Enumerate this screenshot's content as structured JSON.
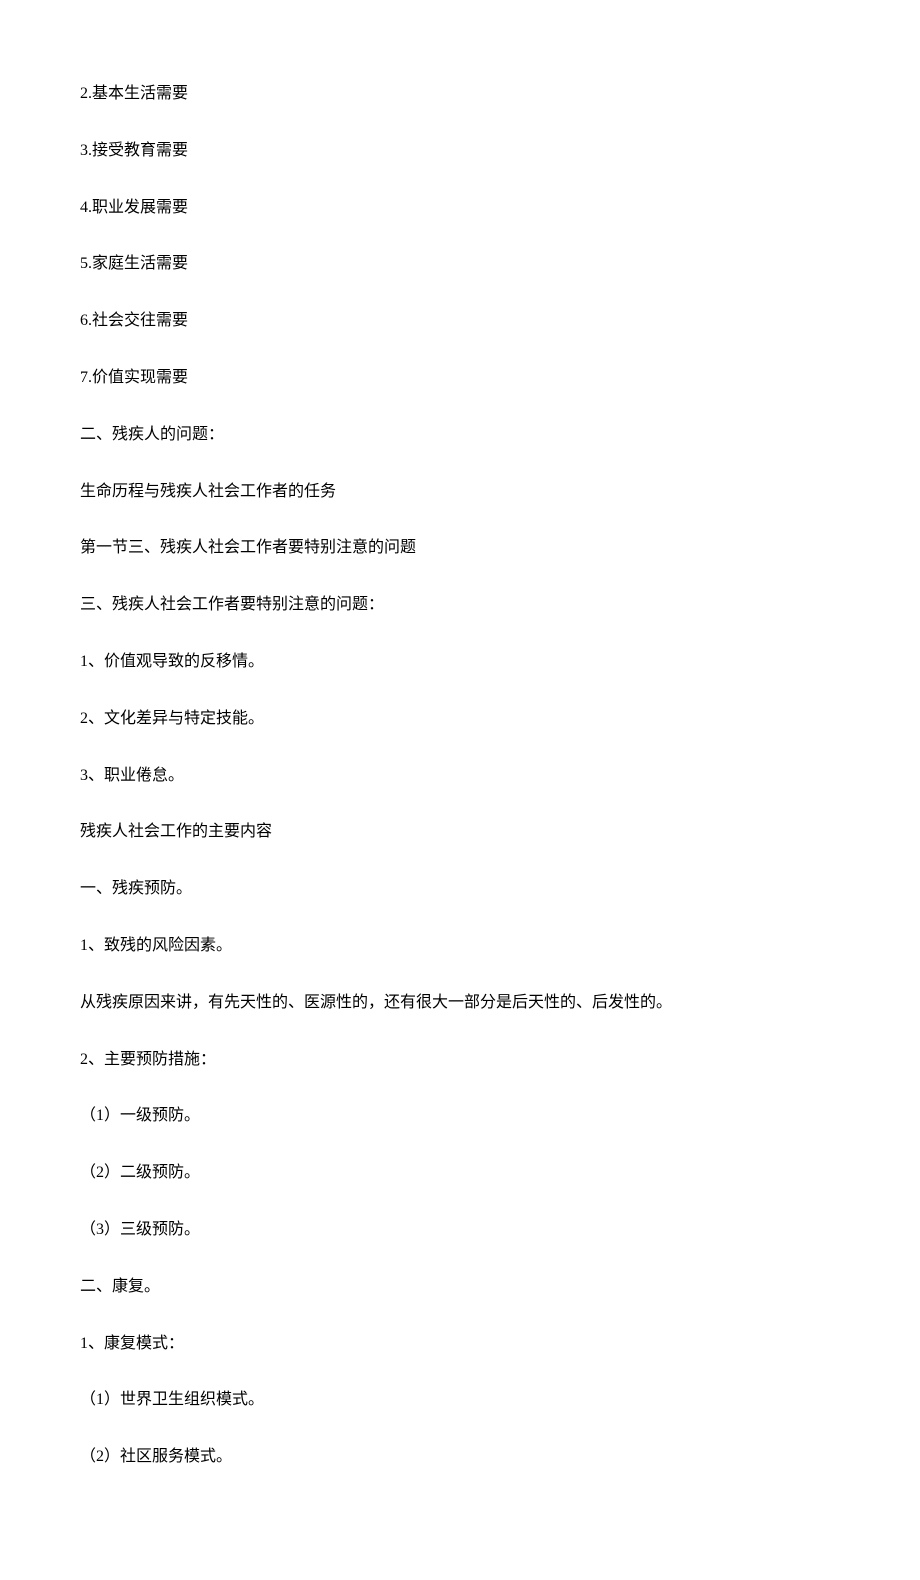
{
  "lines": [
    "2.基本生活需要",
    "3.接受教育需要",
    "4.职业发展需要",
    "5.家庭生活需要",
    "6.社会交往需要",
    "7.价值实现需要",
    "二、残疾人的问题：",
    "生命历程与残疾人社会工作者的任务",
    "第一节三、残疾人社会工作者要特别注意的问题",
    "三、残疾人社会工作者要特别注意的问题：",
    "1、价值观导致的反移情。",
    "2、文化差异与特定技能。",
    "3、职业倦怠。",
    "残疾人社会工作的主要内容",
    "一、残疾预防。",
    "1、致残的风险因素。",
    "从残疾原因来讲，有先天性的、医源性的，还有很大一部分是后天性的、后发性的。",
    "2、主要预防措施：",
    "（1）一级预防。",
    "（2）二级预防。",
    "（3）三级预防。",
    "二、康复。",
    "1、康复模式：",
    "（1）世界卫生组织模式。",
    "（2）社区服务模式。"
  ]
}
